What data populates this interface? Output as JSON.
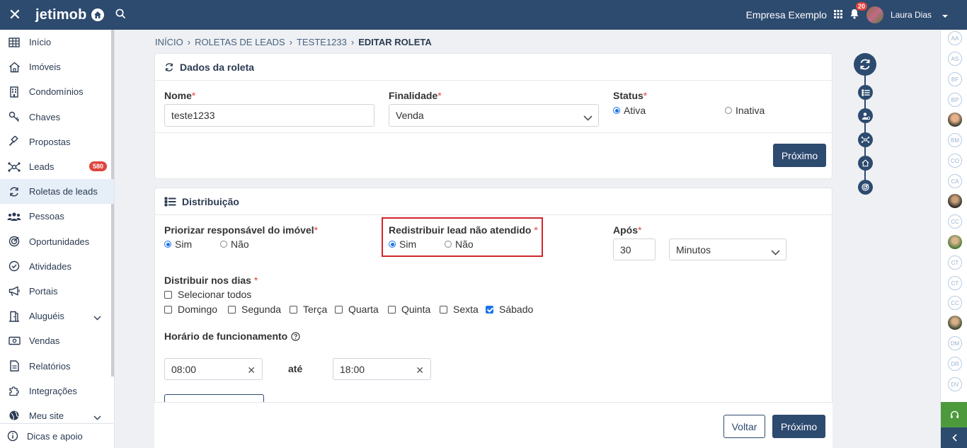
{
  "topbar": {
    "logo_text": "jetimob",
    "company": "Empresa Exemplo",
    "notification_count": "20",
    "user_name": "Laura Dias"
  },
  "sidebar": {
    "items": [
      {
        "label": "Início",
        "icon": "grid-icon"
      },
      {
        "label": "Imóveis",
        "icon": "house-icon"
      },
      {
        "label": "Condomínios",
        "icon": "building-icon"
      },
      {
        "label": "Chaves",
        "icon": "key-icon"
      },
      {
        "label": "Propostas",
        "icon": "gavel-icon"
      },
      {
        "label": "Leads",
        "icon": "leads-network-icon",
        "count": "580"
      },
      {
        "label": "Roletas de leads",
        "icon": "roulette-icon",
        "active": true
      },
      {
        "label": "Pessoas",
        "icon": "people-icon"
      },
      {
        "label": "Oportunidades",
        "icon": "target-icon"
      },
      {
        "label": "Atividades",
        "icon": "check-circle-icon"
      },
      {
        "label": "Portais",
        "icon": "megaphone-icon"
      },
      {
        "label": "Aluguéis",
        "icon": "door-icon",
        "expandable": true
      },
      {
        "label": "Vendas",
        "icon": "money-icon"
      },
      {
        "label": "Relatórios",
        "icon": "document-icon"
      },
      {
        "label": "Integrações",
        "icon": "puzzle-icon"
      },
      {
        "label": "Meu site",
        "icon": "globe-icon",
        "expandable": true
      }
    ],
    "footer_label": "Dicas e apoio"
  },
  "breadcrumb": {
    "items": [
      "INÍCIO",
      "ROLETAS DE LEADS",
      "TESTE1233"
    ],
    "current": "EDITAR ROLETA"
  },
  "dados": {
    "title": "Dados da roleta",
    "nome_label": "Nome",
    "nome_value": "teste1233",
    "finalidade_label": "Finalidade",
    "finalidade_value": "Venda",
    "status_label": "Status",
    "status_options": [
      "Ativa",
      "Inativa"
    ],
    "status_selected": "Ativa",
    "next_label": "Próximo"
  },
  "distribuicao": {
    "title": "Distribuição",
    "priorizar_label": "Priorizar responsável do imóvel",
    "priorizar_options": [
      "Sim",
      "Não"
    ],
    "priorizar_selected": "Sim",
    "redistribuir_label": "Redistribuir lead não atendido",
    "redistribuir_options": [
      "Sim",
      "Não"
    ],
    "redistribuir_selected": "Sim",
    "apos_label": "Após",
    "apos_value": "30",
    "apos_unit": "Minutos",
    "dias_label": "Distribuir nos dias",
    "select_all_label": "Selecionar todos",
    "days": [
      {
        "label": "Domingo",
        "checked": false
      },
      {
        "label": "Segunda",
        "checked": false
      },
      {
        "label": "Terça",
        "checked": false
      },
      {
        "label": "Quarta",
        "checked": false
      },
      {
        "label": "Quinta",
        "checked": false
      },
      {
        "label": "Sexta",
        "checked": false
      },
      {
        "label": "Sábado",
        "checked": true
      }
    ],
    "horario_label": "Horário de funcionamento",
    "start_time": "08:00",
    "ate_label": "até",
    "end_time": "18:00"
  },
  "footer": {
    "back_label": "Voltar",
    "next_label": "Próximo"
  },
  "right_avatars": [
    "AA",
    "AS",
    "BF",
    "BP",
    "",
    "BM",
    "CO",
    "CA",
    "",
    "CC",
    "",
    "CT",
    "CT",
    "CC",
    "",
    "DM",
    "DR",
    "DV"
  ],
  "colors": {
    "primary": "#2d4a6f",
    "accent_blue": "#1a73e8",
    "danger": "#e0443e",
    "highlight_border": "#d0262b",
    "support_green": "#4d9a3d"
  }
}
